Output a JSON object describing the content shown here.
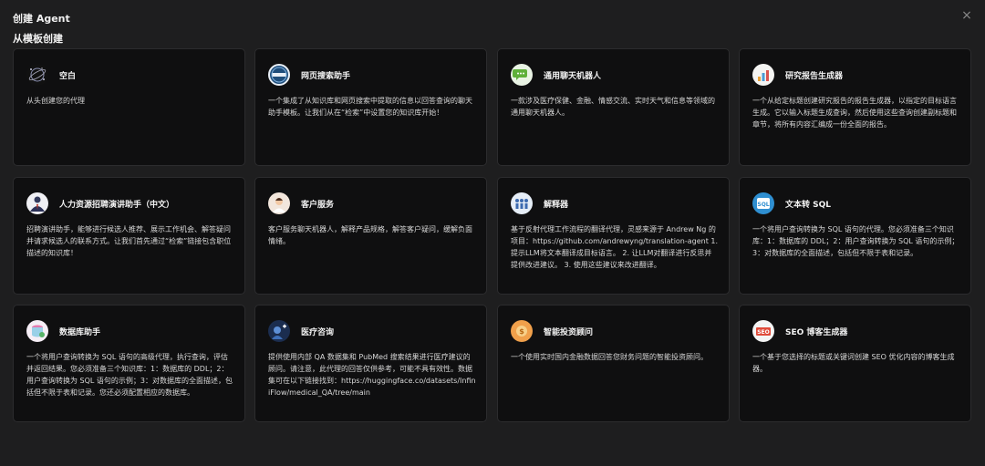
{
  "dialog": {
    "title": "创建 Agent",
    "section_title": "从模板创建",
    "close_label": "×"
  },
  "cards": [
    {
      "name": "空白",
      "desc": "从头创建您的代理",
      "icon": "blank-icon"
    },
    {
      "name": "网页搜索助手",
      "desc": "一个集成了从知识库和网页搜索中提取的信息以回答查询的聊天助手模板。让我们从在“检索”中设置您的知识库开始！",
      "icon": "web-search-icon"
    },
    {
      "name": "通用聊天机器人",
      "desc": "一款涉及医疗保健、金融、情感交流、实时天气和信息等领域的通用聊天机器人。",
      "icon": "chat-bubble-icon"
    },
    {
      "name": "研究报告生成器",
      "desc": "一个从给定标题创建研究报告的报告生成器，以指定的目标语言生成。它以输入标题生成查询，然后使用这些查询创建副标题和章节，将所有内容汇编成一份全面的报告。",
      "icon": "report-icon"
    },
    {
      "name": "人力资源招聘演讲助手（中文）",
      "desc": "招聘演讲助手，能够进行候选人推荐、展示工作机会、解答疑问并请求候选人的联系方式。让我们首先通过“检索”链接包含职位描述的知识库！",
      "icon": "recruiter-icon"
    },
    {
      "name": "客户服务",
      "desc": "客户服务聊天机器人，解释产品规格，解答客户疑问，缓解负面情绪。",
      "icon": "customer-service-icon"
    },
    {
      "name": "解释器",
      "desc": "基于反射代理工作流程的翻译代理，灵感来源于 Andrew Ng 的项目：https://github.com/andrewyng/translation-agent 1. 提示LLM将文本翻译成目标语言。 2. 让LLM对翻译进行反思并提供改进建议。 3. 使用这些建议来改进翻译。",
      "icon": "translator-icon"
    },
    {
      "name": "文本转 SQL",
      "desc": "一个将用户查询转换为 SQL 语句的代理。您必须准备三个知识库：1：数据库的 DDL；2：用户查询转换为 SQL 语句的示例；3：对数据库的全面描述，包括但不限于表和记录。",
      "icon": "sql-icon"
    },
    {
      "name": "数据库助手",
      "desc": "一个将用户查询转换为 SQL 语句的高级代理，执行查询，评估并返回结果。您必须准备三个知识库：1：数据库的 DDL；2：用户查询转换为 SQL 语句的示例；3：对数据库的全面描述，包括但不限于表和记录。您还必须配置相应的数据库。",
      "icon": "database-icon"
    },
    {
      "name": "医疗咨询",
      "desc": "提供使用内部 QA 数据集和 PubMed 搜索结果进行医疗建议的顾问。请注意，此代理的回答仅供参考，可能不具有效性。数据集可在以下链接找到：https://huggingface.co/datasets/InfiniFlow/medical_QA/tree/main",
      "icon": "medical-icon"
    },
    {
      "name": "智能投资顾问",
      "desc": "一个使用实时国内金融数据回答您财务问题的智能投资顾问。",
      "icon": "investment-icon"
    },
    {
      "name": "SEO 博客生成器",
      "desc": "一个基于您选择的标题或关键词创建 SEO 优化内容的博客生成器。",
      "icon": "seo-icon"
    }
  ]
}
